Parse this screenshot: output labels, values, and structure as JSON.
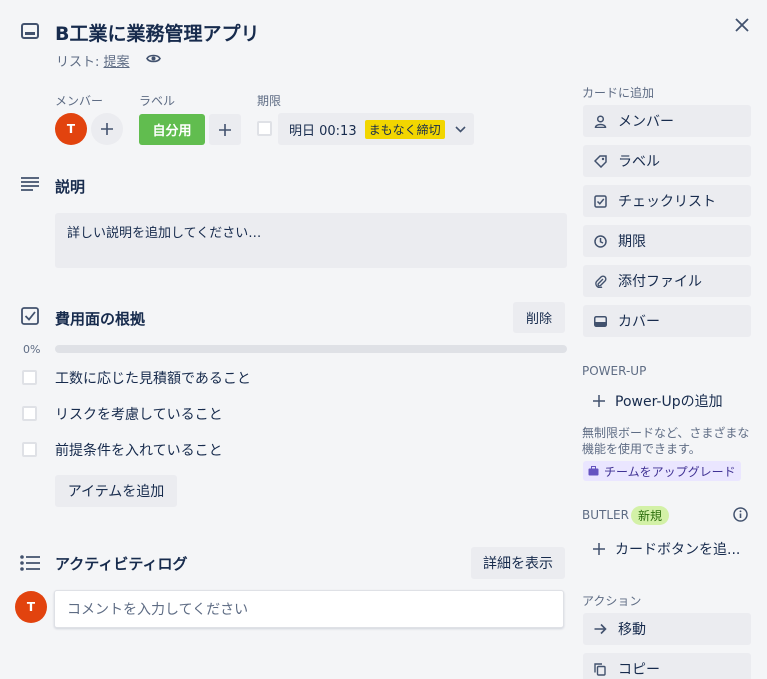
{
  "card": {
    "title": "B工業に業務管理アプリ",
    "list_prefix": "リスト: ",
    "list_name": "提案"
  },
  "meta": {
    "members_label": "メンバー",
    "labels_label": "ラベル",
    "due_label": "期限",
    "member_avatar": "T",
    "label_text": "自分用",
    "label_color": "#61bd4f",
    "due_text": "明日 00:13",
    "due_badge": "まもなく締切",
    "due_badge_color": "#f2d600"
  },
  "description": {
    "title": "説明",
    "placeholder": "詳しい説明を追加してください…"
  },
  "checklist": {
    "title": "費用面の根拠",
    "delete_label": "削除",
    "progress_text": "0%",
    "progress": 0,
    "items": [
      {
        "text": "工数に応じた見積額であること",
        "checked": false
      },
      {
        "text": "リスクを考慮していること",
        "checked": false
      },
      {
        "text": "前提条件を入れていること",
        "checked": false
      }
    ],
    "add_item_label": "アイテムを追加"
  },
  "activity": {
    "title": "アクティビティログ",
    "show_details_label": "詳細を表示",
    "comment_avatar": "T",
    "comment_placeholder": "コメントを入力してください"
  },
  "sidebar": {
    "add_to_card_header": "カードに追加",
    "add_to_card": [
      {
        "label": "メンバー",
        "icon": "person-icon"
      },
      {
        "label": "ラベル",
        "icon": "tag-icon"
      },
      {
        "label": "チェックリスト",
        "icon": "checklist-icon"
      },
      {
        "label": "期限",
        "icon": "clock-icon"
      },
      {
        "label": "添付ファイル",
        "icon": "paperclip-icon"
      },
      {
        "label": "カバー",
        "icon": "cover-icon"
      }
    ],
    "powerup_header": "POWER-UP",
    "add_powerup_label": "Power-Upの追加",
    "upsell_text": "無制限ボードなど、さまざまな機能を使用できます。",
    "upgrade_label": "チームをアップグレード",
    "butler_header": "BUTLER",
    "butler_badge": "新規",
    "add_card_button_label": "カードボタンを追...",
    "actions_header": "アクション",
    "actions": [
      {
        "label": "移動",
        "icon": "arrow-right-icon"
      },
      {
        "label": "コピー",
        "icon": "copy-icon"
      }
    ]
  }
}
